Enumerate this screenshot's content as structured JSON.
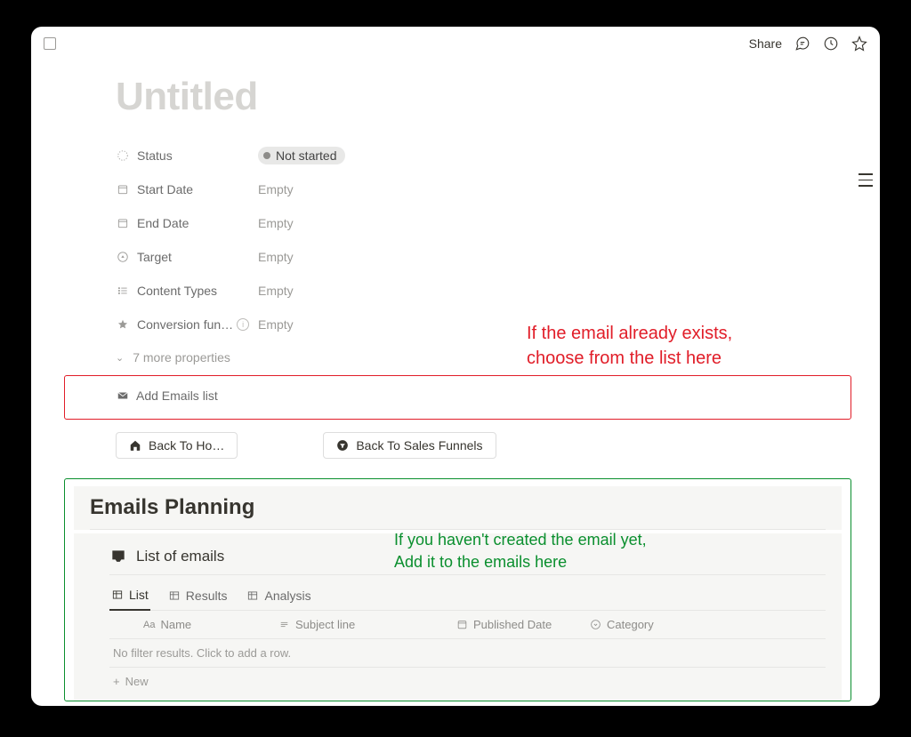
{
  "topbar": {
    "share": "Share"
  },
  "page": {
    "title": "Untitled"
  },
  "properties": [
    {
      "label": "Status",
      "value_type": "status",
      "value": "Not started"
    },
    {
      "label": "Start Date",
      "value_type": "empty",
      "value": "Empty"
    },
    {
      "label": "End Date",
      "value_type": "empty",
      "value": "Empty"
    },
    {
      "label": "Target",
      "value_type": "empty",
      "value": "Empty"
    },
    {
      "label": "Content Types",
      "value_type": "empty",
      "value": "Empty"
    },
    {
      "label": "Conversion fun…",
      "value_type": "empty",
      "value": "Empty"
    }
  ],
  "more_properties": "7 more properties",
  "add_emails": "Add Emails list",
  "annotations": {
    "red_line1": "If the email already exists,",
    "red_line2": "choose from the list here",
    "green_line1": "If you haven't created the email yet,",
    "green_line2": "Add it to the emails here"
  },
  "buttons": {
    "back_home": "Back To Ho…",
    "back_funnels": "Back To Sales Funnels"
  },
  "emails_planning": {
    "heading": "Emails Planning",
    "list_title": "List of emails",
    "tabs": [
      "List",
      "Results",
      "Analysis"
    ],
    "columns": {
      "name": "Name",
      "subject": "Subject line",
      "published": "Published Date",
      "category": "Category"
    },
    "no_results": "No filter results. Click to add a row.",
    "new_label": "New"
  }
}
